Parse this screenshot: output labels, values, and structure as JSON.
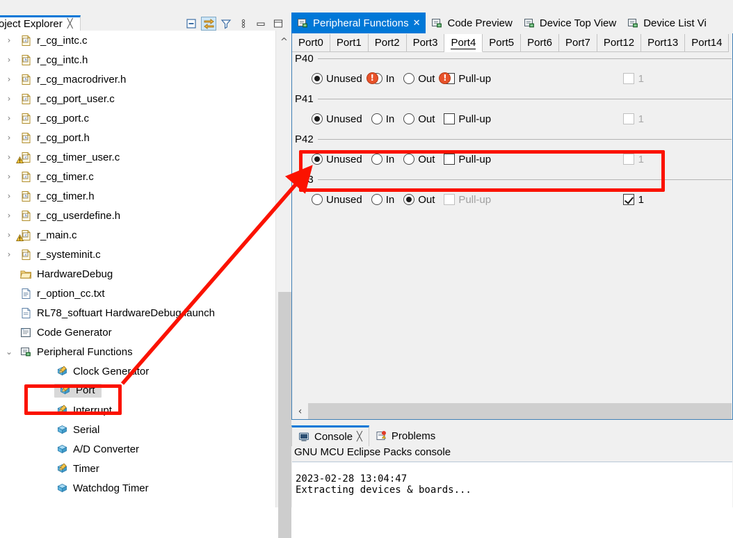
{
  "project_explorer": {
    "tab_label": "oject Explorer",
    "tab_close": "╳",
    "toolbar": [
      {
        "name": "collapse-all-icon",
        "tooltip": "Collapse All"
      },
      {
        "name": "link-with-editor-icon",
        "tooltip": "Link with Editor"
      },
      {
        "name": "filter-icon",
        "tooltip": "Filters"
      },
      {
        "name": "view-menu-icon",
        "tooltip": "View Menu"
      },
      {
        "name": "minimize-icon",
        "tooltip": "Minimize"
      },
      {
        "name": "maximize-icon",
        "tooltip": "Maximize"
      }
    ],
    "tree": [
      {
        "label": "r_cg_intc.c",
        "icon": "c-file-icon",
        "twisty": "›",
        "indent": 1,
        "warn": false,
        "selected": false
      },
      {
        "label": "r_cg_intc.h",
        "icon": "h-file-icon",
        "twisty": "›",
        "indent": 1,
        "warn": false,
        "selected": false
      },
      {
        "label": "r_cg_macrodriver.h",
        "icon": "h-file-icon",
        "twisty": "›",
        "indent": 1,
        "warn": false,
        "selected": false
      },
      {
        "label": "r_cg_port_user.c",
        "icon": "c-file-icon",
        "twisty": "›",
        "indent": 1,
        "warn": false,
        "selected": false
      },
      {
        "label": "r_cg_port.c",
        "icon": "c-file-icon",
        "twisty": "›",
        "indent": 1,
        "warn": false,
        "selected": false
      },
      {
        "label": "r_cg_port.h",
        "icon": "h-file-icon",
        "twisty": "›",
        "indent": 1,
        "warn": false,
        "selected": false
      },
      {
        "label": "r_cg_timer_user.c",
        "icon": "c-file-icon",
        "twisty": "›",
        "indent": 1,
        "warn": true,
        "selected": false
      },
      {
        "label": "r_cg_timer.c",
        "icon": "c-file-icon",
        "twisty": "›",
        "indent": 1,
        "warn": false,
        "selected": false
      },
      {
        "label": "r_cg_timer.h",
        "icon": "h-file-icon",
        "twisty": "›",
        "indent": 1,
        "warn": false,
        "selected": false
      },
      {
        "label": "r_cg_userdefine.h",
        "icon": "h-file-icon",
        "twisty": "›",
        "indent": 1,
        "warn": false,
        "selected": false
      },
      {
        "label": "r_main.c",
        "icon": "c-file-icon",
        "twisty": "›",
        "indent": 1,
        "warn": true,
        "selected": false
      },
      {
        "label": "r_systeminit.c",
        "icon": "c-file-icon",
        "twisty": "›",
        "indent": 1,
        "warn": false,
        "selected": false
      },
      {
        "label": "HardwareDebug",
        "icon": "folder-icon",
        "twisty": "",
        "indent": 1,
        "warn": false,
        "selected": false
      },
      {
        "label": "r_option_cc.txt",
        "icon": "text-file-icon",
        "twisty": "",
        "indent": 1,
        "warn": false,
        "selected": false
      },
      {
        "label": "RL78_softuart HardwareDebug.launch",
        "icon": "launch-file-icon",
        "twisty": "",
        "indent": 1,
        "warn": false,
        "selected": false
      },
      {
        "label": "Code Generator",
        "icon": "code-generator-icon",
        "twisty": "",
        "indent": 1,
        "warn": false,
        "selected": false
      },
      {
        "label": "Peripheral Functions",
        "icon": "peripheral-functions-icon",
        "twisty": "⌄",
        "indent": 1,
        "warn": false,
        "selected": false
      },
      {
        "label": "Clock Generator",
        "icon": "peripheral-node-configured-icon",
        "twisty": "",
        "indent": 3,
        "warn": false,
        "selected": false
      },
      {
        "label": "Port",
        "icon": "peripheral-node-configured-icon",
        "twisty": "",
        "indent": 3,
        "warn": false,
        "selected": true
      },
      {
        "label": "Interrupt",
        "icon": "peripheral-node-configured-icon",
        "twisty": "",
        "indent": 3,
        "warn": false,
        "selected": false
      },
      {
        "label": "Serial",
        "icon": "peripheral-node-icon",
        "twisty": "",
        "indent": 3,
        "warn": false,
        "selected": false
      },
      {
        "label": "A/D Converter",
        "icon": "peripheral-node-icon",
        "twisty": "",
        "indent": 3,
        "warn": false,
        "selected": false
      },
      {
        "label": "Timer",
        "icon": "peripheral-node-configured-icon",
        "twisty": "",
        "indent": 3,
        "warn": false,
        "selected": false
      },
      {
        "label": "Watchdog Timer",
        "icon": "peripheral-node-icon",
        "twisty": "",
        "indent": 3,
        "warn": false,
        "selected": false
      }
    ]
  },
  "editor": {
    "tabs": [
      {
        "label": "Peripheral Functions",
        "icon": "peripheral-functions-icon",
        "active": true,
        "closable": true
      },
      {
        "label": "Code Preview",
        "icon": "code-preview-icon",
        "active": false,
        "closable": false
      },
      {
        "label": "Device Top View",
        "icon": "device-top-view-icon",
        "active": false,
        "closable": false
      },
      {
        "label": "Device List Vi",
        "icon": "device-list-view-icon",
        "active": false,
        "closable": false
      }
    ],
    "tab_close": "✕",
    "port_tabs": [
      {
        "label": "Port0",
        "active": false
      },
      {
        "label": "Port1",
        "active": false
      },
      {
        "label": "Port2",
        "active": false
      },
      {
        "label": "Port3",
        "active": false
      },
      {
        "label": "Port4",
        "active": true
      },
      {
        "label": "Port5",
        "active": false
      },
      {
        "label": "Port6",
        "active": false
      },
      {
        "label": "Port7",
        "active": false
      },
      {
        "label": "Port12",
        "active": false
      },
      {
        "label": "Port13",
        "active": false
      },
      {
        "label": "Port14",
        "active": false
      }
    ],
    "pins": [
      {
        "name": "P40",
        "unused": {
          "label": "Unused",
          "checked": true,
          "error": false
        },
        "in": {
          "label": "In",
          "checked": false,
          "error": true
        },
        "out": {
          "label": "Out",
          "checked": false,
          "error": false
        },
        "pullup": {
          "label": "Pull-up",
          "checked": false,
          "disabled": false,
          "error": true
        },
        "output_level": {
          "label": "1",
          "checked": false,
          "disabled": true
        },
        "highlighted": false
      },
      {
        "name": "P41",
        "unused": {
          "label": "Unused",
          "checked": true,
          "error": false
        },
        "in": {
          "label": "In",
          "checked": false,
          "error": false
        },
        "out": {
          "label": "Out",
          "checked": false,
          "error": false
        },
        "pullup": {
          "label": "Pull-up",
          "checked": false,
          "disabled": false,
          "error": false
        },
        "output_level": {
          "label": "1",
          "checked": false,
          "disabled": true
        },
        "highlighted": false
      },
      {
        "name": "P42",
        "unused": {
          "label": "Unused",
          "checked": true,
          "error": false
        },
        "in": {
          "label": "In",
          "checked": false,
          "error": false
        },
        "out": {
          "label": "Out",
          "checked": false,
          "error": false
        },
        "pullup": {
          "label": "Pull-up",
          "checked": false,
          "disabled": false,
          "error": false
        },
        "output_level": {
          "label": "1",
          "checked": false,
          "disabled": true
        },
        "highlighted": false
      },
      {
        "name": "P43",
        "unused": {
          "label": "Unused",
          "checked": false,
          "error": false
        },
        "in": {
          "label": "In",
          "checked": false,
          "error": false
        },
        "out": {
          "label": "Out",
          "checked": true,
          "error": false
        },
        "pullup": {
          "label": "Pull-up",
          "checked": false,
          "disabled": true,
          "error": false
        },
        "output_level": {
          "label": "1",
          "checked": true,
          "disabled": false
        },
        "highlighted": true
      }
    ],
    "hscroll_arrow": "‹"
  },
  "console": {
    "tabs": [
      {
        "label": "Console",
        "icon": "console-icon",
        "active": true,
        "closable": true
      },
      {
        "label": "Problems",
        "icon": "problems-icon",
        "active": false,
        "closable": false
      }
    ],
    "tab_close": "╳",
    "title": "GNU MCU Eclipse Packs console",
    "lines": [
      "",
      "2023-02-28 13:04:47",
      "Extracting devices & boards..."
    ]
  },
  "annotations": {
    "accent_color": "#fb1200",
    "boxes": [
      "port-tree-item",
      "p43-row"
    ],
    "arrow": "port-to-p43-arrow"
  },
  "colors": {
    "active_tab_blue": "#0078d7",
    "panel_grey": "#f0f0f0",
    "selection_grey": "#d8d8d8",
    "error_orange": "#e8522a",
    "annotation_red": "#fb1200"
  }
}
